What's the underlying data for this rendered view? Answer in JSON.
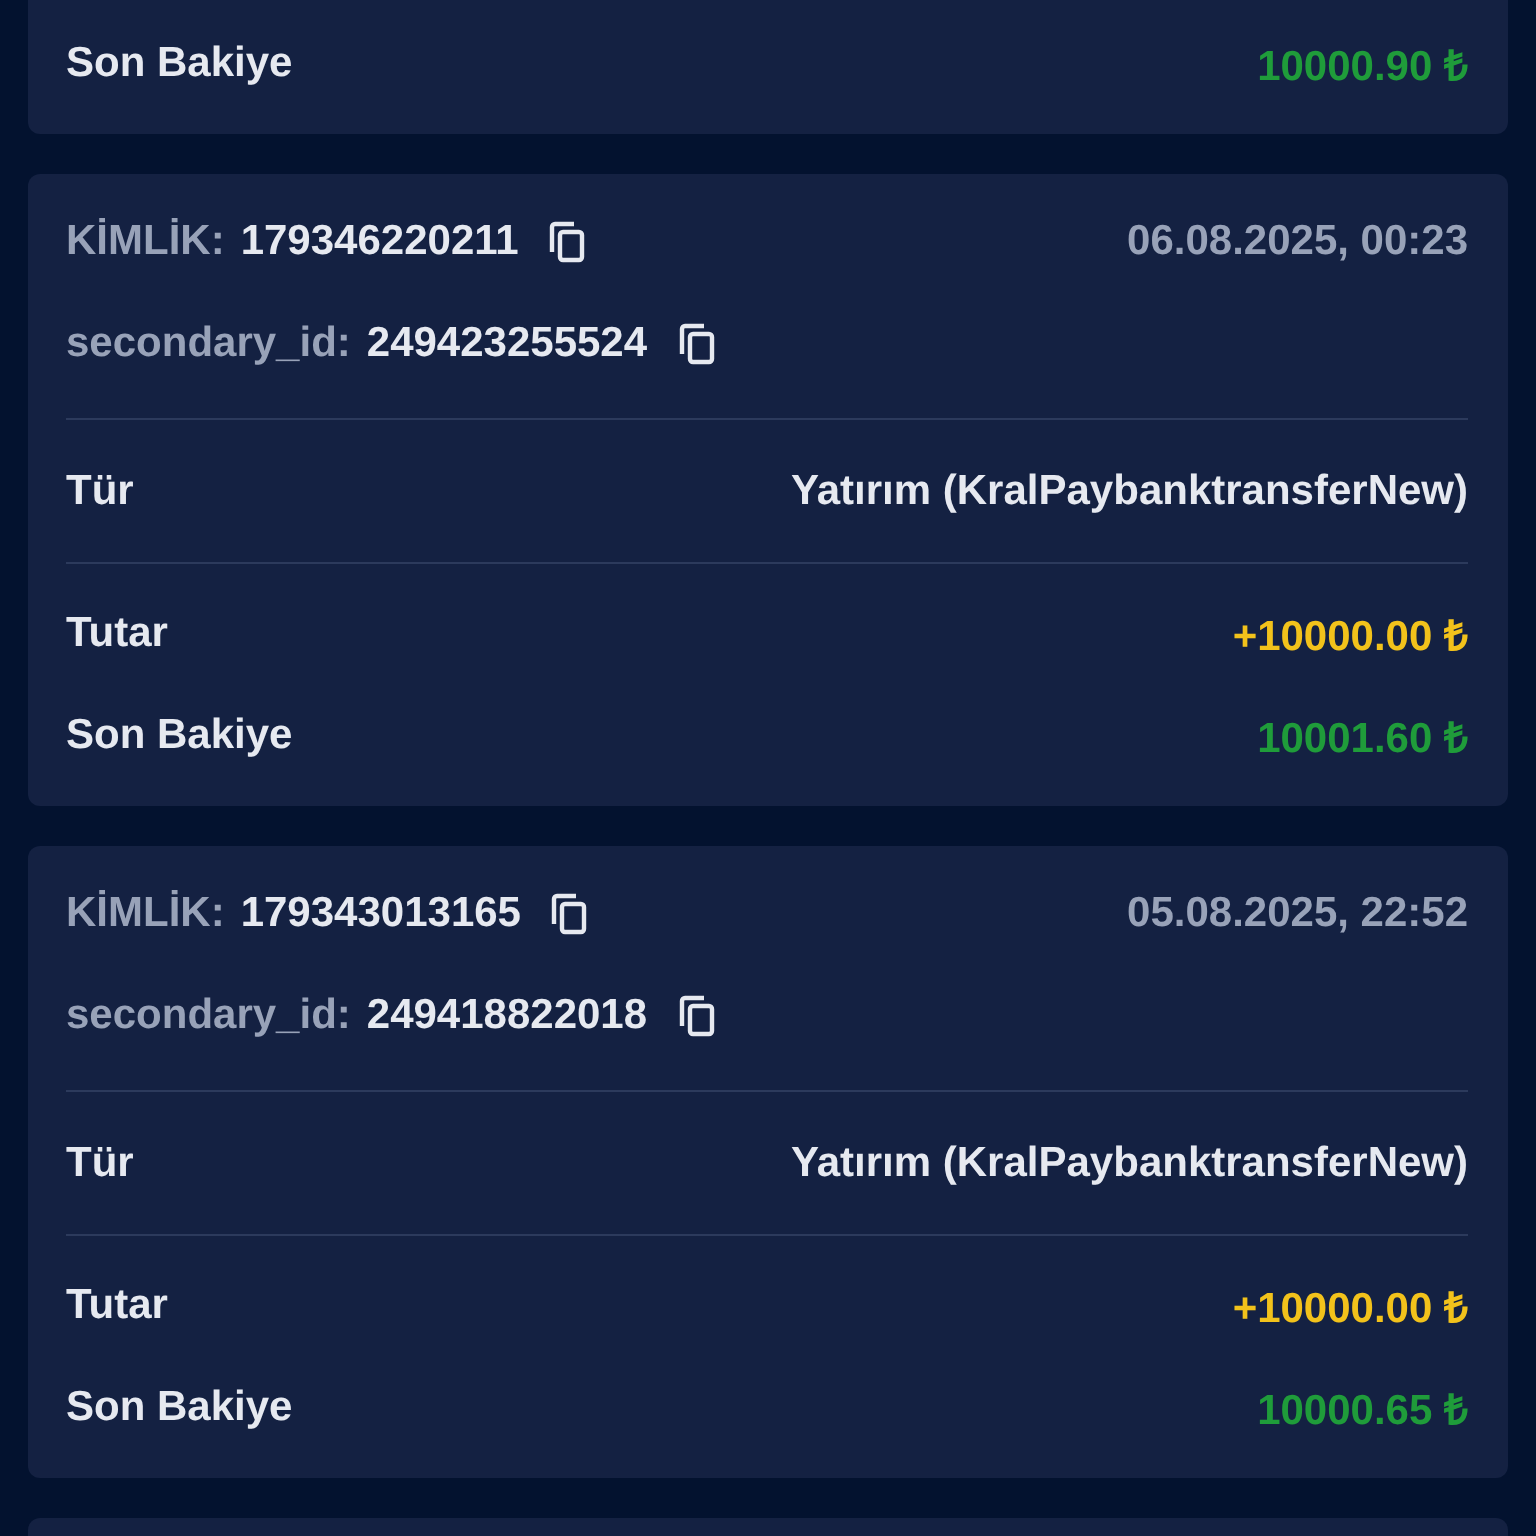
{
  "transactions": [
    {
      "balance_label": "Son Bakiye",
      "balance": "10000.90 ₺"
    },
    {
      "id_label": "KİMLİK:",
      "id": "179346220211",
      "date": "06.08.2025, 00:23",
      "secondary_label": "secondary_id:",
      "secondary_id": "249423255524",
      "type_label": "Tür",
      "type": "Yatırım (KralPaybanktransferNew)",
      "amount_label": "Tutar",
      "amount": "+10000.00 ₺",
      "balance_label": "Son Bakiye",
      "balance": "10001.60 ₺"
    },
    {
      "id_label": "KİMLİK:",
      "id": "179343013165",
      "date": "05.08.2025, 22:52",
      "secondary_label": "secondary_id:",
      "secondary_id": "249418822018",
      "type_label": "Tür",
      "type": "Yatırım (KralPaybanktransferNew)",
      "amount_label": "Tutar",
      "amount": "+10000.00 ₺",
      "balance_label": "Son Bakiye",
      "balance": "10000.65 ₺"
    }
  ]
}
